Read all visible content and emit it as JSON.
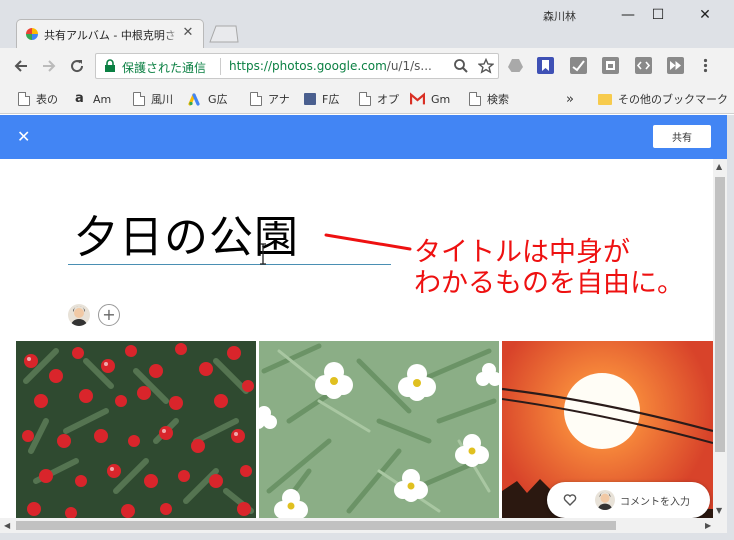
{
  "window": {
    "user": "森川林",
    "tab_title": "共有アルバム - 中根克明さ",
    "minimize": "—",
    "maximize": "☐",
    "close": "✕"
  },
  "toolbar": {
    "secure_label": "保護された通信",
    "url_host": "https://photos.google.com",
    "url_path": "/u/1/s..."
  },
  "bookmarks": {
    "items": [
      {
        "label": "表の",
        "icon": "document-icon"
      },
      {
        "label": "Am",
        "icon": "amazon-icon"
      },
      {
        "label": "風川",
        "icon": "document-icon"
      },
      {
        "label": "G広",
        "icon": "google-ads-icon"
      },
      {
        "label": "アナ",
        "icon": "document-icon"
      },
      {
        "label": "F広",
        "icon": "facebook-ads-icon"
      },
      {
        "label": "オプ",
        "icon": "document-icon"
      },
      {
        "label": "Gm",
        "icon": "gmail-icon"
      },
      {
        "label": "検索",
        "icon": "document-icon"
      }
    ],
    "overflow": "»",
    "other_folder": "その他のブックマーク"
  },
  "appbar": {
    "close": "✕",
    "share_label": "共有"
  },
  "album": {
    "title": "夕日の公園",
    "add_person": "+",
    "annotation_line1": "タイトルは中身が",
    "annotation_line2": "わかるものを自由に。",
    "comment_placeholder": "コメントを入力",
    "photos": [
      "red-berries-photo",
      "white-flowers-photo",
      "sunset-photo"
    ]
  },
  "colors": {
    "accent": "#4285f4",
    "annotation": "#ee1111",
    "secure": "#0b8043"
  }
}
